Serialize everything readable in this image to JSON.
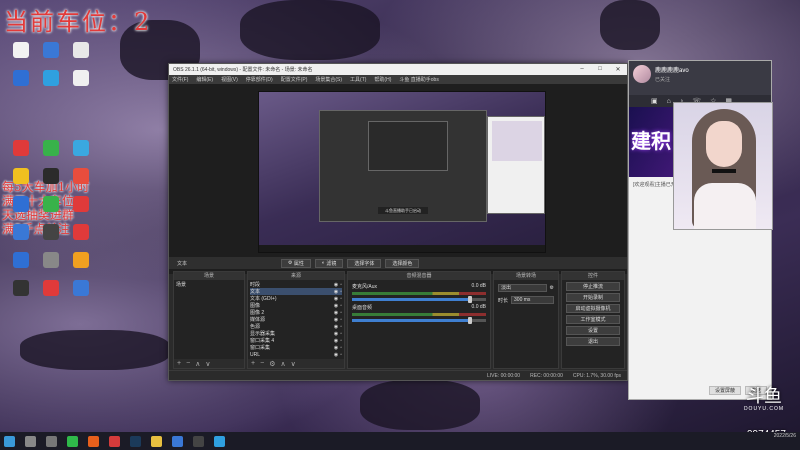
{
  "overlay": {
    "title": "当前车位：2",
    "lines": [
      "每5大车加1小时",
      "满三十大车位",
      "天选抽奖进群",
      "满5千点关注"
    ]
  },
  "desktop_icons": [
    {
      "label": "",
      "color": "#f2f2f2"
    },
    {
      "label": "",
      "color": "#3a78d6"
    },
    {
      "label": "",
      "color": "#e8e8e8"
    },
    {
      "label": "",
      "color": "#2f6fd4"
    },
    {
      "label": "",
      "color": "#2fa0e0"
    },
    {
      "label": "",
      "color": "#f0f0f0"
    },
    {
      "label": "",
      "color": "#e03a3a"
    },
    {
      "label": "",
      "color": "#38b24a"
    },
    {
      "label": "",
      "color": "#3aa8e0"
    },
    {
      "label": "",
      "color": "#f0c020"
    },
    {
      "label": "",
      "color": "#2b2b2b"
    },
    {
      "label": "",
      "color": "#e84d3d"
    },
    {
      "label": "",
      "color": "#2f6fd4"
    },
    {
      "label": "",
      "color": "#38b24a"
    },
    {
      "label": "",
      "color": "#e03a3a"
    },
    {
      "label": "",
      "color": "#3a78d6"
    },
    {
      "label": "",
      "color": "#444"
    },
    {
      "label": "",
      "color": "#e03a3a"
    },
    {
      "label": "",
      "color": "#2f6fd4"
    },
    {
      "label": "",
      "color": "#888"
    },
    {
      "label": "",
      "color": "#f0a020"
    },
    {
      "label": "",
      "color": "#333"
    },
    {
      "label": "",
      "color": "#e03a3a"
    },
    {
      "label": "",
      "color": "#3a78d6"
    }
  ],
  "obs": {
    "title": "OBS 26.1.1 (64-bit, windows) - 配置文件: 未命名 - 场景: 未命名",
    "menu": [
      "文件(F)",
      "编辑(E)",
      "视图(V)",
      "停靠部件(D)",
      "配置文件(P)",
      "场景集合(S)",
      "工具(T)",
      "帮助(H)",
      "斗鱼 直播助手obs"
    ],
    "preview_label": "文本",
    "properties_button": "属性",
    "filters_button": "滤镜",
    "select_font": "选择字体",
    "select_color": "选择颜色",
    "docks": {
      "scenes": {
        "title": "场景",
        "items": [
          "场景"
        ]
      },
      "sources": {
        "title": "来源",
        "items": [
          "时段",
          "文本",
          "文本 (GDI+)",
          "图像",
          "图像 2",
          "媒体源",
          "色源",
          "显示器采集",
          "窗口采集 4",
          "窗口采集",
          "URL"
        ]
      },
      "mixer": {
        "title": "音频混音器",
        "channels": [
          {
            "name": "麦克风/Aux",
            "db": "0.0 dB",
            "level": 0.88
          },
          {
            "name": "桌面音频",
            "db": "0.0 dB",
            "level": 0.88
          }
        ]
      },
      "transitions": {
        "title": "场景转场",
        "type": "淡出",
        "duration_label": "时长",
        "duration": "300 ms"
      },
      "controls": {
        "title": "控件",
        "buttons": [
          "停止推流",
          "开始录制",
          "启动虚拟摄像机",
          "工作室模式",
          "设置",
          "退出"
        ]
      }
    },
    "status": {
      "live": "LIVE: 00:00:00",
      "rec": "REC: 00:00:00",
      "cpu": "CPU: 1.7%, 30.00 fps"
    },
    "nested_popup": "斗鱼直播助手已启动"
  },
  "chat": {
    "name": "鹿鹿鹿鹿avo",
    "sub": "已关注",
    "banner_text": "建积",
    "message": "[欢迎观看]主播已开播",
    "buttons": [
      "设置屏蔽",
      "发送"
    ],
    "toolbar_icons": [
      "video-icon",
      "home-icon",
      "mic-icon",
      "phone-icon",
      "star-icon",
      "grid-icon",
      "plus-icon"
    ]
  },
  "douyu": {
    "mark": "斗鱼",
    "sub": "DOUYU.COM"
  },
  "room_id": "9974457",
  "tray": {
    "time": "",
    "date": "2022/5/26"
  },
  "taskbar_icons": [
    {
      "name": "start-icon",
      "color": "#3a9ad9"
    },
    {
      "name": "search-icon",
      "color": "#888"
    },
    {
      "name": "task-view-icon",
      "color": "#777"
    },
    {
      "name": "wechat-icon",
      "color": "#2fb94a"
    },
    {
      "name": "douyu-icon",
      "color": "#e8601c"
    },
    {
      "name": "netease-icon",
      "color": "#d43b3b"
    },
    {
      "name": "steam-icon",
      "color": "#1b3a5a"
    },
    {
      "name": "explorer-icon",
      "color": "#e8c040"
    },
    {
      "name": "app-icon",
      "color": "#3a78d6"
    },
    {
      "name": "obs-icon",
      "color": "#444"
    },
    {
      "name": "app2-icon",
      "color": "#2fa0e0"
    }
  ]
}
